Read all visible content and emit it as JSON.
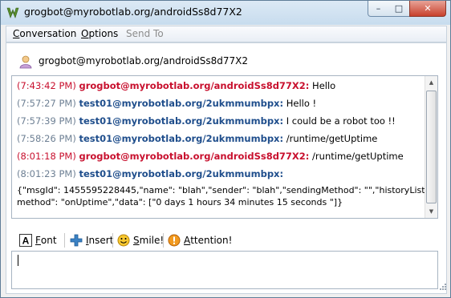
{
  "window": {
    "title": "grogbot@myrobotlab.org/androidSs8d77X2",
    "controls": {
      "minimize": "–",
      "maximize": "□",
      "close": "✕"
    }
  },
  "menu": {
    "items": [
      {
        "label": "Conversation",
        "mnemonic": "C",
        "enabled": true
      },
      {
        "label": "Options",
        "mnemonic": "O",
        "enabled": true
      },
      {
        "label": "Send To",
        "mnemonic": "",
        "enabled": false
      }
    ]
  },
  "contact": {
    "name": "grogbot@myrobotlab.org/androidSs8d77X2",
    "icon": "user-icon"
  },
  "chat": {
    "messages": [
      {
        "time": "(7:43:42 PM)",
        "sender": "grogbot@myrobotlab.org/androidSs8d77X2:",
        "text": " Hello",
        "side": "remote"
      },
      {
        "time": "(7:57:27 PM)",
        "sender": "test01@myrobotlab.org/2ukmmumbpx:",
        "text": " Hello !",
        "side": "local"
      },
      {
        "time": "(7:57:39 PM)",
        "sender": "test01@myrobotlab.org/2ukmmumbpx:",
        "text": " I could be a robot too !!",
        "side": "local"
      },
      {
        "time": "(7:58:26 PM)",
        "sender": "test01@myrobotlab.org/2ukmmumbpx:",
        "text": " /runtime/getUptime",
        "side": "local"
      },
      {
        "time": "(8:01:18 PM)",
        "sender": "grogbot@myrobotlab.org/androidSs8d77X2:",
        "text": " /runtime/getUptime",
        "side": "remote"
      },
      {
        "time": "(8:01:23 PM)",
        "sender": "test01@myrobotlab.org/2ukmmumbpx:",
        "text": "",
        "side": "local"
      }
    ],
    "raw_lines": [
      "{\"msgId\": 1455595228445,\"name\": \"blah\",\"sender\": \"blah\",\"sendingMethod\": \"\",\"historyList\": [],\"",
      "method\": \"onUptime\",\"data\": [\"0 days 1 hours 34 minutes 15 seconds \"]}"
    ],
    "colors": {
      "remote": "#c8102e",
      "local": "#1f4e8c",
      "timestamp": "#6e8094"
    }
  },
  "toolbar": {
    "font": {
      "label": "Font",
      "mnemonic": "F",
      "icon": "font-icon"
    },
    "insert": {
      "label": "Insert",
      "mnemonic": "I",
      "icon": "plus-icon"
    },
    "smile": {
      "label": "Smile!",
      "mnemonic": "S",
      "icon": "smiley-icon"
    },
    "attention": {
      "label": "Attention!",
      "mnemonic": "A",
      "icon": "attention-icon"
    }
  },
  "input": {
    "value": ""
  }
}
